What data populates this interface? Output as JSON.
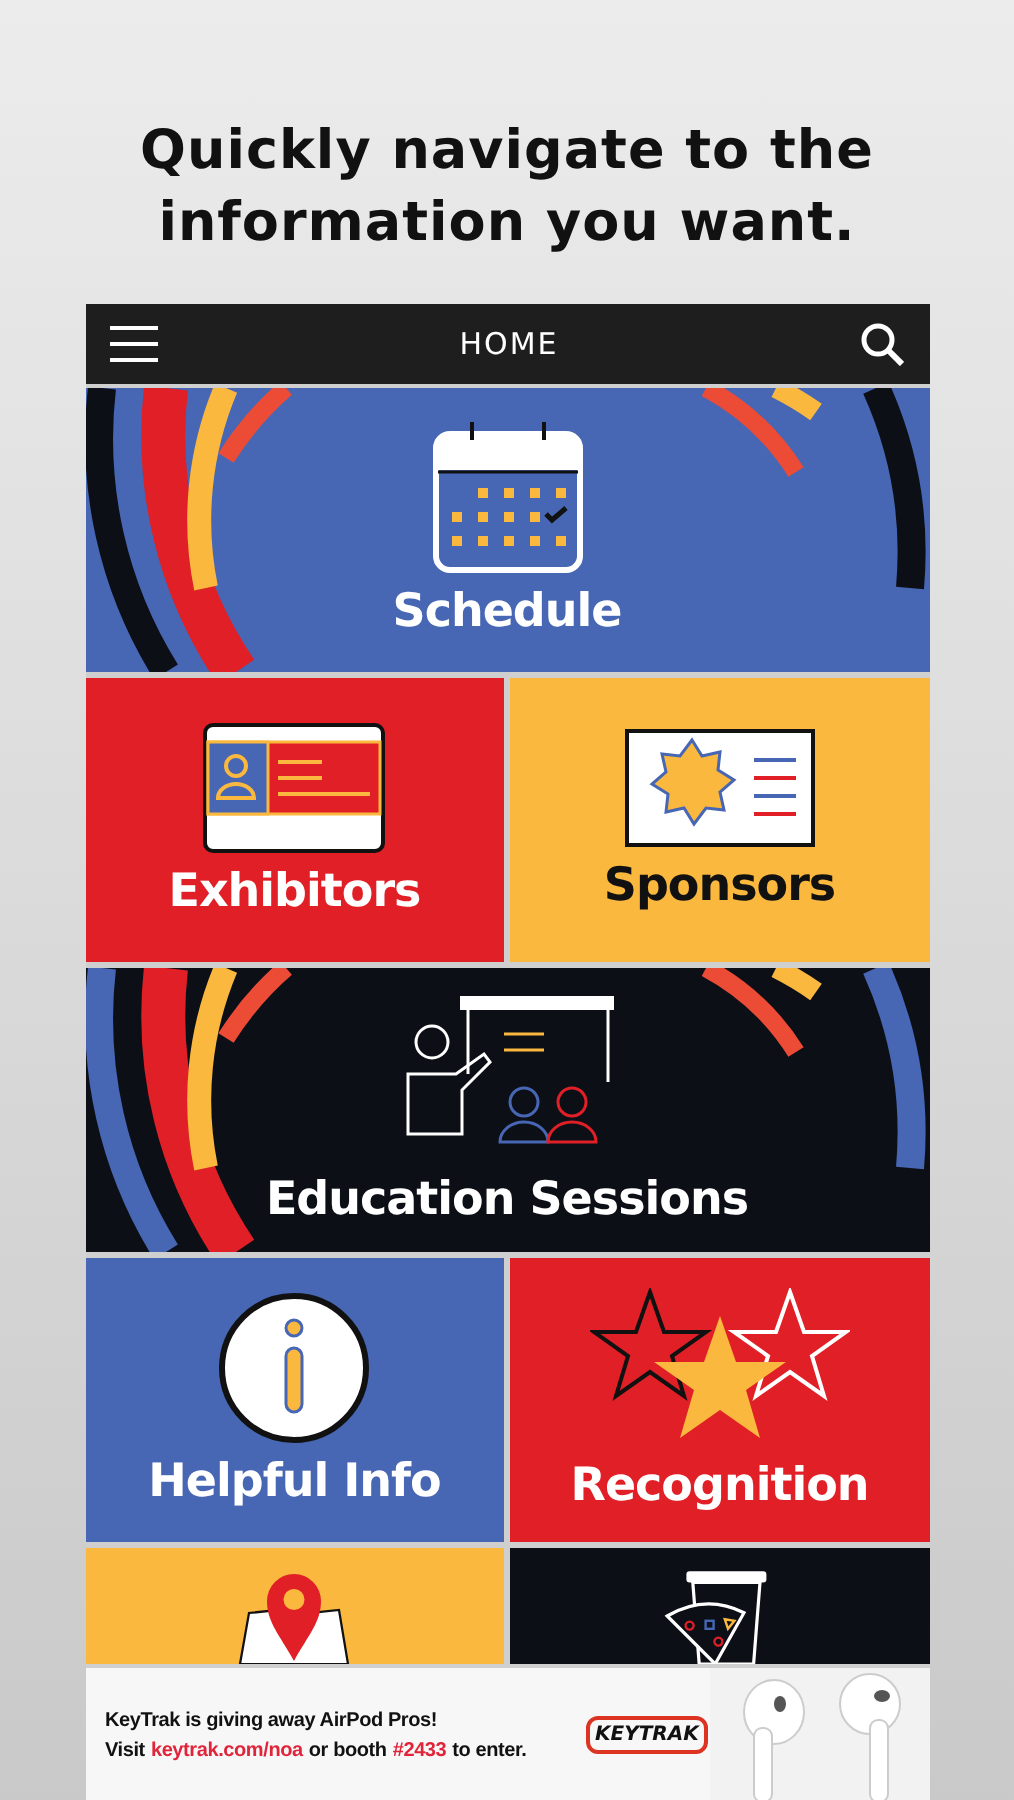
{
  "headline": "Quickly navigate to the information you want.",
  "top_bar": {
    "title": "HOME"
  },
  "tiles": [
    {
      "kind": "schedule",
      "label": "Schedule",
      "color": "#4767b4",
      "wide": true
    },
    {
      "kind": "exhibitors",
      "label": "Exhibitors",
      "color": "#e01f26",
      "wide": false
    },
    {
      "kind": "sponsors",
      "label": "Sponsors",
      "color": "#fbb83e",
      "wide": false
    },
    {
      "kind": "education",
      "label": "Education Sessions",
      "color": "#0d0f17",
      "wide": true
    },
    {
      "kind": "info",
      "label": "Helpful Info",
      "color": "#4767b4",
      "wide": false
    },
    {
      "kind": "recognition",
      "label": "Recognition",
      "color": "#e01f26",
      "wide": false
    },
    {
      "kind": "map",
      "color": "#fbb83e",
      "wide": false
    },
    {
      "kind": "food",
      "color": "#0d0f17",
      "wide": false
    }
  ],
  "ad": {
    "line1": "KeyTrak is giving away AirPod Pros!",
    "line2": [
      {
        "kind": "plain",
        "text": "Visit"
      },
      {
        "kind": "link",
        "text": "keytrak.com/noa"
      },
      {
        "kind": "plain",
        "text": "or booth"
      },
      {
        "kind": "link",
        "text": "#2433"
      },
      {
        "kind": "plain",
        "text": "to enter."
      }
    ],
    "logo": "KEYTRAK"
  }
}
